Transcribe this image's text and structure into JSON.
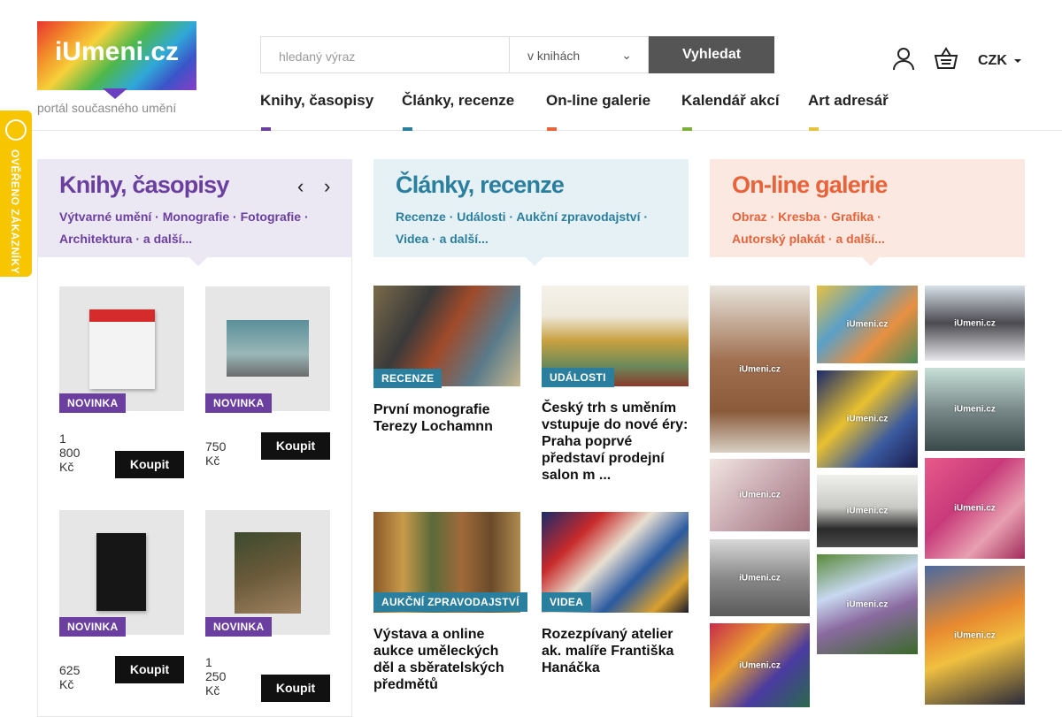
{
  "header": {
    "logo_text": "iUmeni.cz",
    "logo_tagline": "portál současného umění",
    "search_placeholder": "hledaný výraz",
    "search_scope": "v knihách",
    "search_button": "Vyhledat",
    "currency": "CZK",
    "nav": [
      {
        "label": "Knihy, časopisy",
        "color": "#6b3fa0"
      },
      {
        "label": "Články, recenze",
        "color": "#2a7f9e"
      },
      {
        "label": "On-line galerie",
        "color": "#e8623a"
      },
      {
        "label": "Kalendář akcí",
        "color": "#7bb03a"
      },
      {
        "label": "Art adresář",
        "color": "#e8c23a"
      }
    ]
  },
  "side_badge": {
    "label": "OVĚŘENO ZÁKAZNÍKY",
    "color": "#f7c600"
  },
  "books": {
    "title": "Knihy, časopisy",
    "color": "#6b3fa0",
    "bg": "#ece8f3",
    "cats": [
      "Výtvarné umění",
      "Monografie",
      "Fotografie",
      "Architektura",
      "a další..."
    ],
    "items": [
      {
        "tag": "NOVINKA",
        "price": "1 800 Kč",
        "buy": "Koupit"
      },
      {
        "tag": "NOVINKA",
        "price": "750 Kč",
        "buy": "Koupit"
      },
      {
        "tag": "NOVINKA",
        "price": "625 Kč",
        "buy": "Koupit"
      },
      {
        "tag": "NOVINKA",
        "price": "1 250 Kč",
        "buy": "Koupit"
      }
    ]
  },
  "articles": {
    "title": "Články, recenze",
    "color": "#2a7f9e",
    "bg": "#e6f1f6",
    "cats": [
      "Recenze",
      "Události",
      "Aukční zpravodajství",
      "Videa",
      "a další..."
    ],
    "items": [
      {
        "tag": "RECENZE",
        "title": "První monografie Terezy Lochamnn"
      },
      {
        "tag": "UDÁLOSTI",
        "title": "Český trh s uměním vstupuje do nové éry: Praha poprvé představí prodejní salon m ..."
      },
      {
        "tag": "AUKČNÍ ZPRAVODAJSTVÍ",
        "title": "Výstava a online aukce uměleckých děl a sběratelských předmětů"
      },
      {
        "tag": "VIDEA",
        "title": "Rozezpívaný atelier ak. malíře Františka Hanáčka"
      }
    ]
  },
  "gallery": {
    "title": "On-line galerie",
    "color": "#e8623a",
    "bg": "#fbe9e1",
    "cats": [
      "Obraz",
      "Kresba",
      "Grafika",
      "Autorský plakát",
      "a další..."
    ],
    "watermark": "iUmeni.cz"
  }
}
